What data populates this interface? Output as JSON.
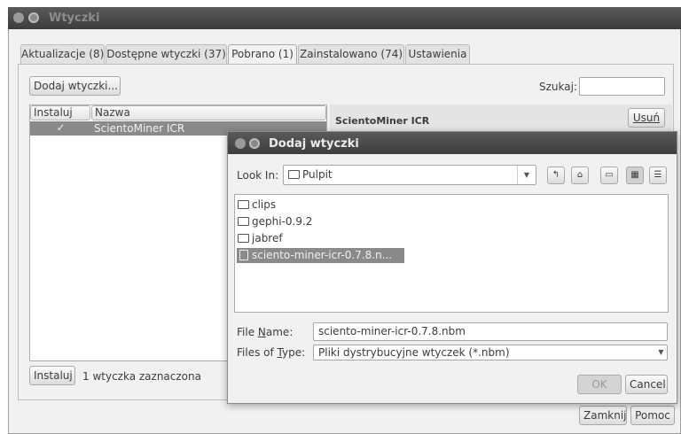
{
  "main_window": {
    "title": "Wtyczki",
    "tabs": [
      {
        "label": "Aktualizacje (8)"
      },
      {
        "label": "Dostępne wtyczki (37)"
      },
      {
        "label": "Pobrano (1)"
      },
      {
        "label": "Zainstalowano (74)"
      },
      {
        "label": "Ustawienia"
      }
    ],
    "add_plugins_label": "Dodaj wtyczki...",
    "search_label": "Szukaj:",
    "search_value": "",
    "table_headers": {
      "install": "Instaluj",
      "name": "Nazwa"
    },
    "table_rows": [
      {
        "checked": true,
        "name": "ScientoMiner ICR"
      }
    ],
    "detail_title": "ScientoMiner ICR",
    "remove_label": "Usuń",
    "install_label": "Instaluj",
    "status_text": "1 wtyczka zaznaczona",
    "close_label": "Zamknij",
    "help_label": "Pomoc"
  },
  "dialog": {
    "title": "Dodaj wtyczki",
    "look_in_label": "Look In:",
    "look_in_value": "Pulpit",
    "files": [
      {
        "name": "clips",
        "type": "folder"
      },
      {
        "name": "gephi-0.9.2",
        "type": "folder"
      },
      {
        "name": "jabref",
        "type": "folder"
      },
      {
        "name": "sciento-miner-icr-0.7.8.n...",
        "type": "file",
        "selected": true
      }
    ],
    "file_name_label": "File Name:",
    "file_name_value": "sciento-miner-icr-0.7.8.nbm",
    "file_type_label": "Files of Type:",
    "file_type_value": "Pliki dystrybucyjne wtyczek (*.nbm)",
    "ok_label": "OK",
    "cancel_label": "Cancel"
  },
  "icons": [
    "close-icon",
    "minimize-icon",
    "checkbox-icon",
    "folder-icon",
    "file-icon",
    "up-folder-icon",
    "home-icon",
    "new-folder-icon",
    "list-view-icon",
    "details-view-icon",
    "dropdown-arrow-icon"
  ]
}
